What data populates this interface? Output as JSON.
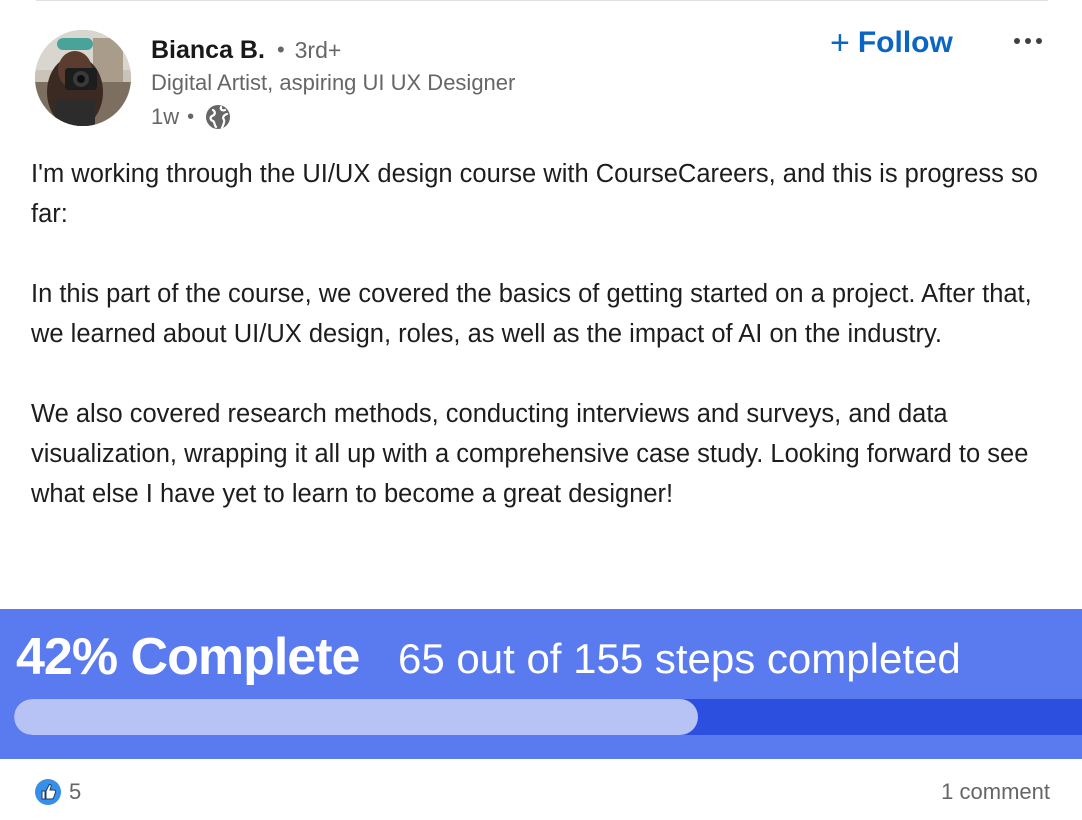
{
  "post": {
    "author": {
      "name": "Bianca B.",
      "degree": "3rd+",
      "headline": "Digital Artist, aspiring UI UX Designer",
      "time": "1w",
      "separator": "•",
      "visibility_icon": "globe-icon",
      "avatar_icon": "profile-photo"
    },
    "actions": {
      "follow_label": "Follow",
      "follow_icon": "+",
      "more_icon": "more-horizontal-icon"
    },
    "body": {
      "paragraphs": [
        "I'm working through the UI/UX design course with CourseCareers, and this is progress so far:",
        "In this part of the course, we covered the basics of getting started on a project. After that, we learned about UI/UX design, roles, as well as the impact of AI on the industry.",
        "We also covered research methods, conducting interviews and surveys, and data visualization, wrapping it all up with a comprehensive case study. Looking forward to see what else I have yet to learn to become a great designer!"
      ]
    },
    "attachment": {
      "percent_label": "42% Complete",
      "steps_label": "65 out of 155 steps completed",
      "progress": 0.42,
      "colors": {
        "background": "#5a7af0",
        "track": "#2d4fe0",
        "fill": "#b7c3f4"
      }
    },
    "social": {
      "reaction_icon": "like-icon",
      "reactions": "5",
      "comments": "1 comment"
    }
  },
  "colors": {
    "link": "#0a66c2",
    "secondary_text": "#666666",
    "primary_text": "#1d1d1d"
  }
}
